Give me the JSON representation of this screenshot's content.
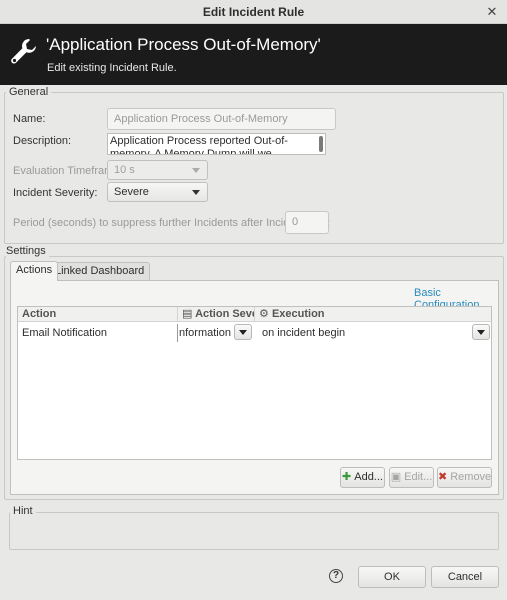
{
  "window": {
    "title": "Edit Incident Rule"
  },
  "banner": {
    "title": "'Application Process Out-of-Memory'",
    "subtitle": "Edit existing Incident Rule."
  },
  "general": {
    "legend": "General",
    "name_label": "Name:",
    "name_value": "Application Process Out-of-Memory",
    "description_label": "Description:",
    "description_value": "Application Process reported Out-of-memory. A Memory Dump will we automatically triggered if",
    "evaluation_label": "Evaluation Timeframe:",
    "evaluation_value": "10 s",
    "severity_label": "Incident Severity:",
    "severity_value": "Severe",
    "period_label": "Period (seconds) to suppress further Incidents after Incident End:",
    "period_value": "0"
  },
  "settings": {
    "legend": "Settings",
    "tabs": [
      {
        "label": "Actions"
      },
      {
        "label": "Linked Dashboard"
      }
    ],
    "basic_config_link": "Basic Configuration",
    "columns": [
      "Action",
      "Action Severit",
      "Execution"
    ],
    "rows": [
      {
        "action": "Email Notification",
        "severity": "nformational",
        "execution": "on incident begin"
      }
    ],
    "add_label": "Add...",
    "edit_label": "Edit...",
    "remove_label": "Remove"
  },
  "hint": {
    "legend": "Hint"
  },
  "footer": {
    "ok_label": "OK",
    "cancel_label": "Cancel",
    "help_glyph": "?"
  },
  "colors": {
    "banner_bg": "#1b1b1b",
    "link": "#2a8bbd",
    "add_icon": "#3a9a3a",
    "remove_icon": "#c0392b"
  }
}
